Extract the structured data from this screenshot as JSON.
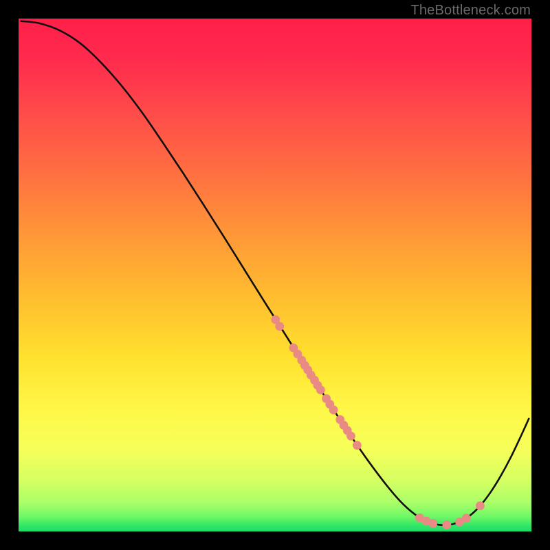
{
  "attribution": "TheBottleneck.com",
  "colors": {
    "curve_stroke": "#111111",
    "dot_fill": "#e98a84",
    "green_band": "#1edb69"
  },
  "chart_data": {
    "type": "line",
    "title": "",
    "xlabel": "",
    "ylabel": "",
    "xlim": [
      0,
      100
    ],
    "ylim": [
      0,
      100
    ],
    "curve": [
      {
        "x": 0.5,
        "y": 99.5
      },
      {
        "x": 4,
        "y": 99.1
      },
      {
        "x": 8,
        "y": 97.7
      },
      {
        "x": 12,
        "y": 95.2
      },
      {
        "x": 16,
        "y": 91.5
      },
      {
        "x": 20,
        "y": 87.0
      },
      {
        "x": 24,
        "y": 81.8
      },
      {
        "x": 28,
        "y": 76.0
      },
      {
        "x": 32,
        "y": 70.0
      },
      {
        "x": 36,
        "y": 63.8
      },
      {
        "x": 40,
        "y": 57.5
      },
      {
        "x": 44,
        "y": 51.1
      },
      {
        "x": 48,
        "y": 44.7
      },
      {
        "x": 52,
        "y": 38.4
      },
      {
        "x": 56,
        "y": 32.1
      },
      {
        "x": 60,
        "y": 25.9
      },
      {
        "x": 64,
        "y": 19.8
      },
      {
        "x": 68,
        "y": 14.0
      },
      {
        "x": 72,
        "y": 8.7
      },
      {
        "x": 75,
        "y": 5.3
      },
      {
        "x": 78,
        "y": 2.8
      },
      {
        "x": 80,
        "y": 1.8
      },
      {
        "x": 82,
        "y": 1.3
      },
      {
        "x": 84,
        "y": 1.3
      },
      {
        "x": 86,
        "y": 1.9
      },
      {
        "x": 88,
        "y": 3.1
      },
      {
        "x": 90,
        "y": 5.0
      },
      {
        "x": 92,
        "y": 7.6
      },
      {
        "x": 94,
        "y": 10.8
      },
      {
        "x": 96,
        "y": 14.5
      },
      {
        "x": 98,
        "y": 18.7
      },
      {
        "x": 99.5,
        "y": 22.0
      }
    ],
    "dots": [
      {
        "x": 50.1,
        "y": 41.3
      },
      {
        "x": 50.9,
        "y": 40.0
      },
      {
        "x": 53.6,
        "y": 35.8
      },
      {
        "x": 54.4,
        "y": 34.6
      },
      {
        "x": 55.2,
        "y": 33.4
      },
      {
        "x": 55.8,
        "y": 32.4
      },
      {
        "x": 56.4,
        "y": 31.5
      },
      {
        "x": 57.0,
        "y": 30.5
      },
      {
        "x": 57.7,
        "y": 29.5
      },
      {
        "x": 58.3,
        "y": 28.5
      },
      {
        "x": 58.9,
        "y": 27.6
      },
      {
        "x": 60.0,
        "y": 25.9
      },
      {
        "x": 60.7,
        "y": 24.8
      },
      {
        "x": 61.4,
        "y": 23.7
      },
      {
        "x": 62.7,
        "y": 21.8
      },
      {
        "x": 63.4,
        "y": 20.7
      },
      {
        "x": 64.1,
        "y": 19.7
      },
      {
        "x": 64.8,
        "y": 18.6
      },
      {
        "x": 66.0,
        "y": 16.8
      },
      {
        "x": 78.2,
        "y": 2.66
      },
      {
        "x": 79.5,
        "y": 2.01
      },
      {
        "x": 80.8,
        "y": 1.58
      },
      {
        "x": 83.5,
        "y": 1.28
      },
      {
        "x": 86.0,
        "y": 1.86
      },
      {
        "x": 87.3,
        "y": 2.57
      },
      {
        "x": 90.0,
        "y": 5.0
      }
    ],
    "gradient_stops": [
      {
        "offset": 0.0,
        "color": "#ff1f4a"
      },
      {
        "offset": 0.08,
        "color": "#ff2b4d"
      },
      {
        "offset": 0.18,
        "color": "#ff4a4a"
      },
      {
        "offset": 0.3,
        "color": "#ff6f41"
      },
      {
        "offset": 0.42,
        "color": "#ff9738"
      },
      {
        "offset": 0.54,
        "color": "#ffbc2f"
      },
      {
        "offset": 0.66,
        "color": "#ffe12e"
      },
      {
        "offset": 0.76,
        "color": "#fff747"
      },
      {
        "offset": 0.84,
        "color": "#f6ff59"
      },
      {
        "offset": 0.9,
        "color": "#d6ff62"
      },
      {
        "offset": 0.945,
        "color": "#a9ff68"
      },
      {
        "offset": 0.972,
        "color": "#6cf766"
      },
      {
        "offset": 0.988,
        "color": "#33e766"
      },
      {
        "offset": 1.0,
        "color": "#1edb69"
      }
    ]
  }
}
